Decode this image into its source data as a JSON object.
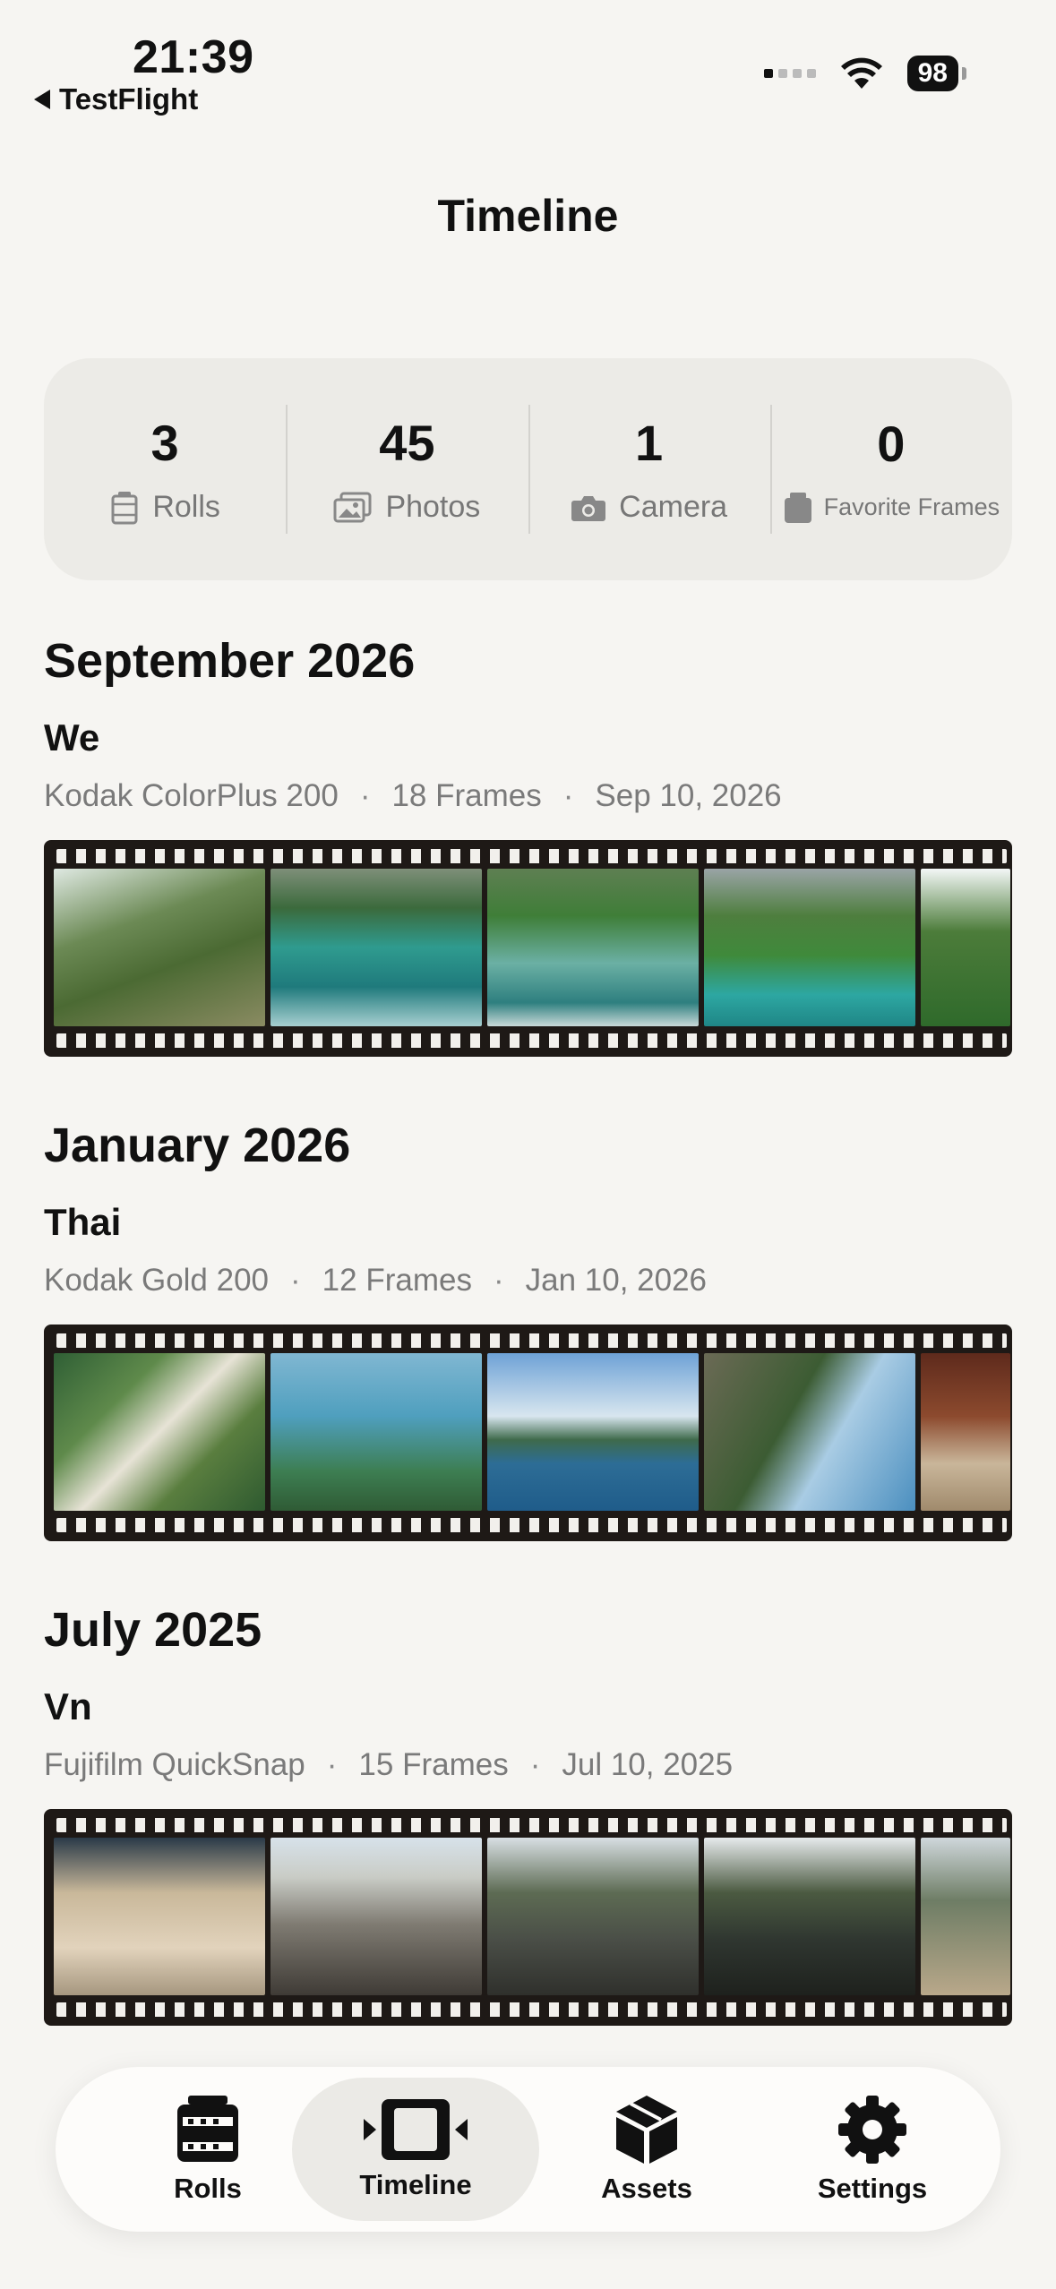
{
  "status": {
    "time": "21:39",
    "back_label": "TestFlight",
    "battery": "98"
  },
  "title": "Timeline",
  "stats": [
    {
      "value": "3",
      "label": "Rolls",
      "icon": "film-roll-icon"
    },
    {
      "value": "45",
      "label": "Photos",
      "icon": "photos-icon"
    },
    {
      "value": "1",
      "label": "Camera",
      "icon": "camera-icon"
    },
    {
      "value": "0",
      "label": "Favorite Frames",
      "icon": "favorite-frames-icon"
    }
  ],
  "sections": [
    {
      "month": "September 2026",
      "roll": {
        "name": "We",
        "film": "Kodak ColorPlus 200",
        "frames": "18 Frames",
        "date": "Sep 10, 2026"
      }
    },
    {
      "month": "January 2026",
      "roll": {
        "name": "Thai",
        "film": "Kodak Gold 200",
        "frames": "12 Frames",
        "date": "Jan 10, 2026"
      }
    },
    {
      "month": "July 2025",
      "roll": {
        "name": "Vn",
        "film": "Fujifilm QuickSnap",
        "frames": "15 Frames",
        "date": "Jul 10, 2025"
      }
    }
  ],
  "separator": "·",
  "tabs": [
    {
      "label": "Rolls",
      "icon": "film-roll-icon"
    },
    {
      "label": "Timeline",
      "icon": "timeline-icon",
      "active": true
    },
    {
      "label": "Assets",
      "icon": "box-icon"
    },
    {
      "label": "Settings",
      "icon": "gear-icon"
    }
  ]
}
